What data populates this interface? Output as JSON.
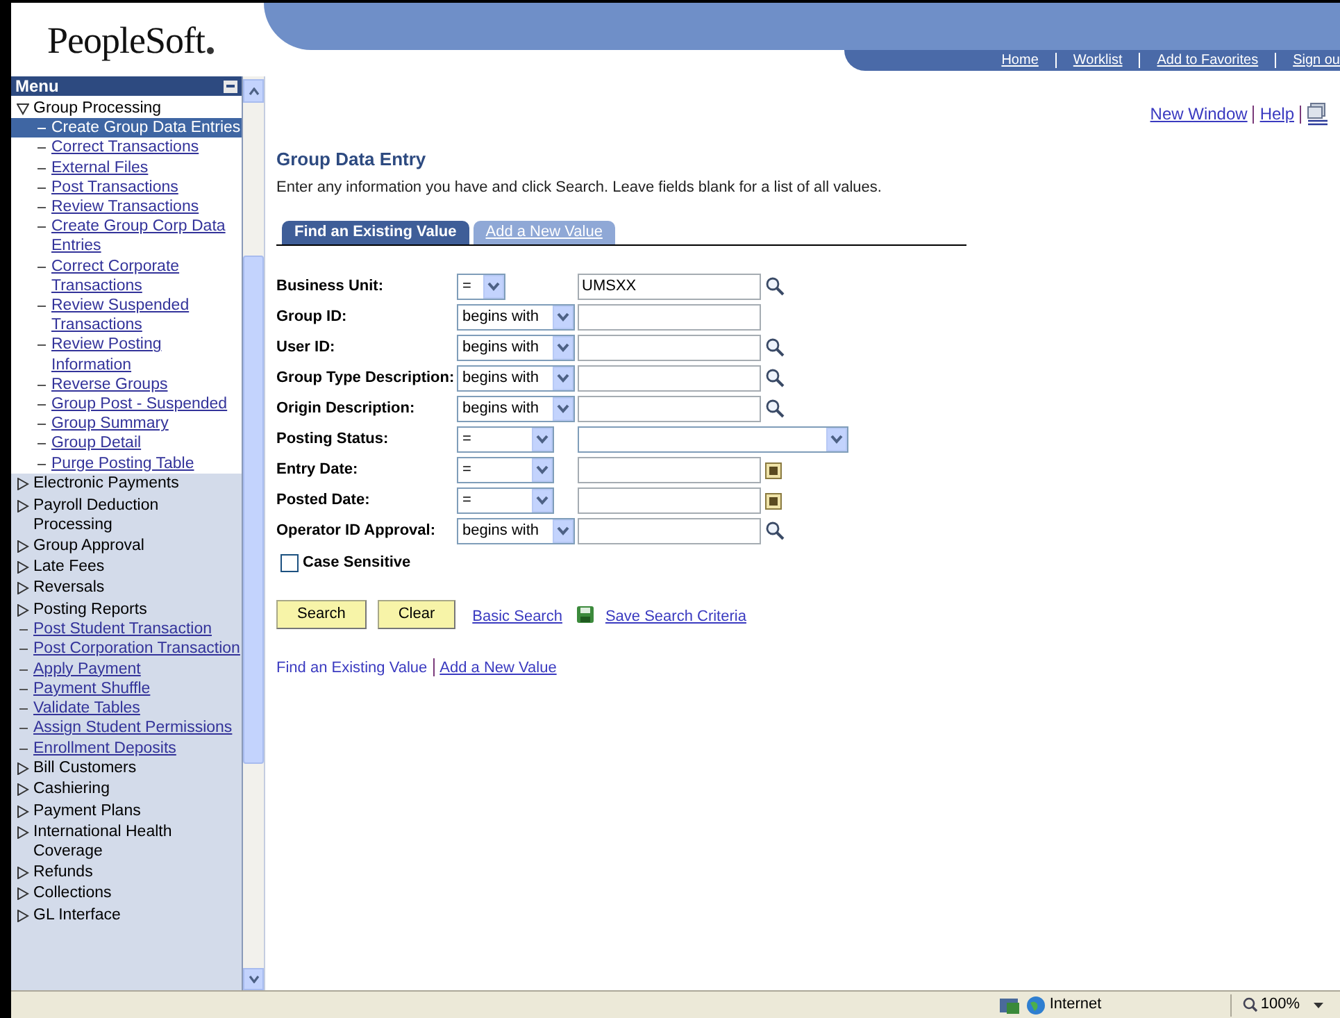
{
  "header": {
    "logo": "PeopleSoft",
    "nav_links": [
      "Home",
      "Worklist",
      "Add to Favorites",
      "Sign ou"
    ]
  },
  "menu": {
    "title": "Menu",
    "items": [
      {
        "kind": "group",
        "children": [
          {
            "kind": "folder",
            "label": "Group Processing",
            "expanded": true,
            "children": [
              {
                "kind": "link",
                "label": "Create Group Data Entries",
                "selected": true
              },
              {
                "kind": "link",
                "label": "Correct Transactions",
                "selected": false
              },
              {
                "kind": "link",
                "label": "External Files",
                "selected": false
              },
              {
                "kind": "link",
                "label": "Post Transactions",
                "selected": false
              },
              {
                "kind": "link",
                "label": "Review Transactions",
                "selected": false
              },
              {
                "kind": "link",
                "label": "Create Group Corp Data Entries",
                "selected": false
              },
              {
                "kind": "link",
                "label": "Correct Corporate Transactions",
                "selected": false
              },
              {
                "kind": "link",
                "label": "Review Suspended Transactions",
                "selected": false
              },
              {
                "kind": "link",
                "label": "Review Posting Information",
                "selected": false
              },
              {
                "kind": "link",
                "label": "Reverse Groups",
                "selected": false
              },
              {
                "kind": "link",
                "label": "Group Post - Suspended",
                "selected": false
              },
              {
                "kind": "link",
                "label": "Group Summary",
                "selected": false
              },
              {
                "kind": "link",
                "label": "Group Detail",
                "selected": false
              },
              {
                "kind": "link",
                "label": "Purge Posting Table",
                "selected": false
              }
            ]
          },
          {
            "kind": "folder",
            "label": "Electronic Payments",
            "expanded": false
          },
          {
            "kind": "folder",
            "label": "Payroll Deduction Processing",
            "expanded": false
          },
          {
            "kind": "folder",
            "label": "Group Approval",
            "expanded": false
          },
          {
            "kind": "folder",
            "label": "Late Fees",
            "expanded": false
          },
          {
            "kind": "folder",
            "label": "Reversals",
            "expanded": false
          },
          {
            "kind": "folder",
            "label": "Posting Reports",
            "expanded": false
          },
          {
            "kind": "link",
            "label": "Post Student Transaction",
            "selected": false
          },
          {
            "kind": "link",
            "label": "Post Corporation Transaction",
            "selected": false
          },
          {
            "kind": "link",
            "label": "Apply Payment",
            "selected": false
          },
          {
            "kind": "link",
            "label": "Payment Shuffle",
            "selected": false
          },
          {
            "kind": "link",
            "label": "Validate Tables",
            "selected": false
          },
          {
            "kind": "link",
            "label": "Assign Student Permissions",
            "selected": false
          },
          {
            "kind": "link",
            "label": "Enrollment Deposits",
            "selected": false
          }
        ]
      },
      {
        "kind": "folder",
        "label": "Bill Customers",
        "expanded": false
      },
      {
        "kind": "folder",
        "label": "Cashiering",
        "expanded": false
      },
      {
        "kind": "folder",
        "label": "Payment Plans",
        "expanded": false
      },
      {
        "kind": "folder",
        "label": "International Health Coverage",
        "expanded": false
      },
      {
        "kind": "folder",
        "label": "Refunds",
        "expanded": false
      },
      {
        "kind": "folder",
        "label": "Collections",
        "expanded": false
      },
      {
        "kind": "folder",
        "label": "GL Interface",
        "expanded": false
      }
    ]
  },
  "top_links": [
    "New Window",
    "Help"
  ],
  "page": {
    "title": "Group Data Entry",
    "instructions": "Enter any information you have and click Search. Leave fields blank for a list of all values.",
    "tabs": [
      {
        "label": "Find an Existing Value",
        "selected": true
      },
      {
        "label": "Add a New Value",
        "selected": false
      }
    ],
    "fields": [
      {
        "label": "Business Unit:",
        "operator": "=",
        "compact": true,
        "value": "UMSXX",
        "kind": "lookup"
      },
      {
        "label": "Group ID:",
        "operator": "begins with",
        "compact": false,
        "kind": "plain"
      },
      {
        "label": "User ID:",
        "operator": "begins with",
        "compact": false,
        "kind": "lookup"
      },
      {
        "label": "Group Type Description:",
        "operator": "begins with",
        "compact": false,
        "kind": "lookup"
      },
      {
        "label": "Origin Description:",
        "operator": "begins with",
        "compact": false,
        "kind": "lookup"
      },
      {
        "label": "Posting Status:",
        "operator": "=",
        "compact": false,
        "kind": "select"
      },
      {
        "label": "Entry Date:",
        "operator": "=",
        "compact": false,
        "kind": "date"
      },
      {
        "label": "Posted Date:",
        "operator": "=",
        "compact": false,
        "kind": "date"
      },
      {
        "label": "Operator ID Approval:",
        "operator": "begins with",
        "compact": false,
        "kind": "lookup"
      }
    ],
    "case_sensitive": {
      "label": "Case Sensitive",
      "checked": false
    },
    "buttons": [
      "Search",
      "Clear"
    ],
    "links": [
      "Basic Search",
      "Save Search Criteria"
    ],
    "bottom_links": [
      "Find an Existing Value",
      "Add a New Value"
    ]
  },
  "status_bar": {
    "zone": "Internet",
    "zoom": "100%"
  }
}
